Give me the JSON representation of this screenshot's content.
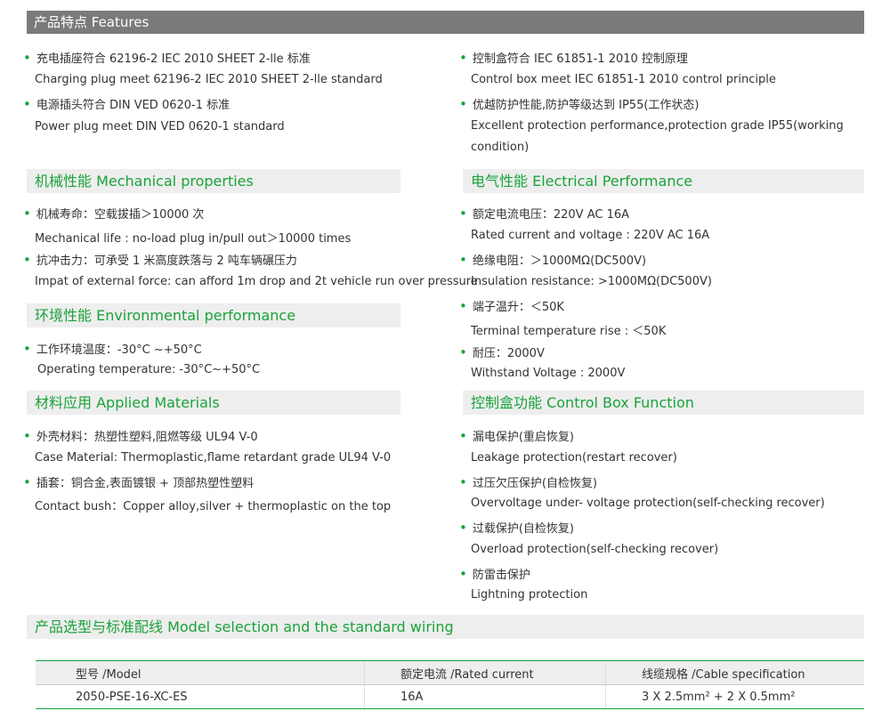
{
  "header": {
    "title": "产品特点 Features"
  },
  "features": {
    "left": [
      {
        "cn": "充电插座符合 62196-2 IEC 2010 SHEET 2-lle 标准",
        "en": "Charging plug meet 62196-2 IEC 2010 SHEET 2-lle standard"
      },
      {
        "cn": "电源插头符合 DIN VED 0620-1 标准",
        "en": "Power plug meet DIN VED 0620-1 standard"
      }
    ],
    "right": [
      {
        "cn": "控制盒符合 IEC 61851-1 2010 控制原理",
        "en": "Control box meet IEC 61851-1 2010 control principle"
      },
      {
        "cn": "优越防护性能,防护等级达到 IP55(工作状态)",
        "en": "Excellent protection performance,protection grade IP55(working condition)"
      }
    ]
  },
  "mechanical": {
    "title": "机械性能 Mechanical properties",
    "items": [
      {
        "cn": "机械寿命：空载拔插＞10000 次",
        "en": "Mechanical life : no-load plug in/pull out＞10000 times"
      },
      {
        "cn": "抗冲击力：可承受 1 米高度跌落与 2 吨车辆碾压力",
        "en": "Impat of external force: can afford 1m drop and 2t vehicle run over pressure"
      }
    ]
  },
  "environmental": {
    "title": "环境性能 Environmental performance",
    "items": [
      {
        "cn": "工作环境温度：-30°C ~+50°C",
        "en": "Operating temperature: -30°C~+50°C"
      }
    ]
  },
  "materials": {
    "title": "材料应用 Applied Materials",
    "items": [
      {
        "cn": "外壳材料：热塑性塑料,阻燃等级 UL94 V-0",
        "en": "Case Material: Thermoplastic,flame retardant grade UL94 V-0"
      },
      {
        "cn": "插套：铜合金,表面镀银 + 顶部热塑性塑料",
        "en": "Contact bush：Copper alloy,silver + thermoplastic on the top"
      }
    ]
  },
  "electrical": {
    "title": "电气性能 Electrical Performance",
    "items": [
      {
        "cn": "额定电流电压：220V AC 16A",
        "en": "Rated current and voltage : 220V AC 16A"
      },
      {
        "cn": "绝缘电阻：＞1000MΩ(DC500V)",
        "en": "Insulation resistance: >1000MΩ(DC500V)"
      },
      {
        "cn": "端子温升：＜50K",
        "en": "Terminal temperature rise : ＜50K"
      },
      {
        "cn": "耐压：2000V",
        "en": "Withstand Voltage : 2000V"
      }
    ]
  },
  "control_box": {
    "title": "控制盒功能 Control Box Function",
    "items": [
      {
        "cn": "漏电保护(重启恢复)",
        "en": "Leakage protection(restart recover)"
      },
      {
        "cn": "过压欠压保护(自检恢复)",
        "en": "Overvoltage under- voltage protection(self-checking recover)"
      },
      {
        "cn": "过载保护(自检恢复)",
        "en": "Overload protection(self-checking recover)"
      },
      {
        "cn": "防雷击保护",
        "en": "Lightning protection"
      }
    ]
  },
  "model": {
    "title": "产品选型与标准配线 Model selection and the standard wiring",
    "headers": [
      "型号 /Model",
      "额定电流 /Rated current",
      "线缆规格 /Cable specification"
    ],
    "rows": [
      [
        "2050-PSE-16-XC-ES",
        "16A",
        "3 X 2.5mm² + 2 X 0.5mm²"
      ]
    ]
  },
  "colors": {
    "accent": "#1aa33a",
    "header_bg": "#7a7a7a",
    "section_bg": "#eeeeee"
  }
}
